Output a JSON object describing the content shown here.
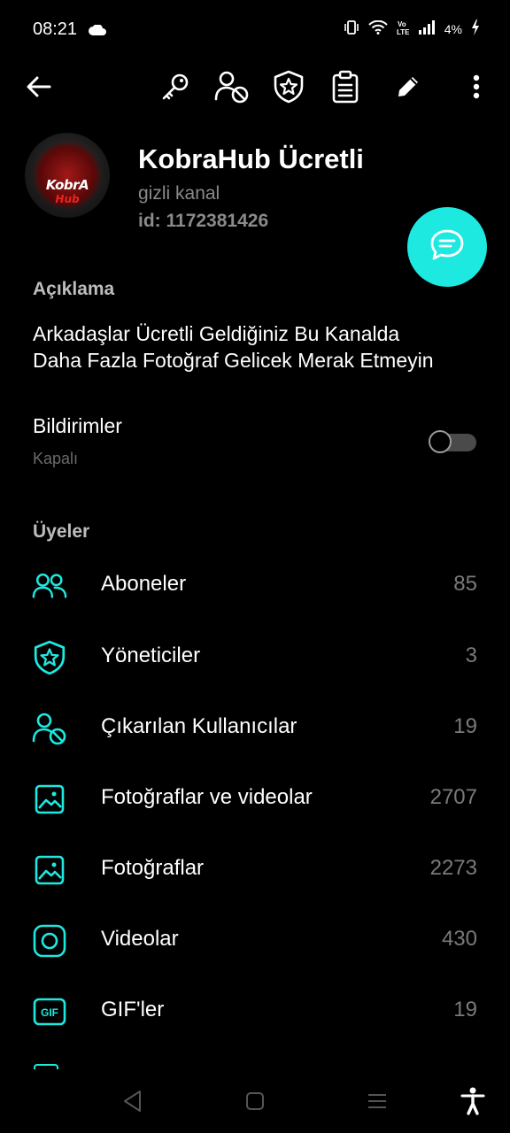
{
  "status_bar": {
    "time": "08:21",
    "battery": "4%",
    "icons": [
      "cloud-icon",
      "vibrate-icon",
      "wifi-icon",
      "volte-icon",
      "signal-icon",
      "battery-charging-icon"
    ]
  },
  "toolbar": {
    "icons": [
      "back-arrow-icon",
      "key-icon",
      "user-block-icon",
      "shield-star-icon",
      "clipboard-icon",
      "pencil-icon",
      "more-vertical-icon"
    ]
  },
  "channel": {
    "avatar_text_top": "KobrA",
    "avatar_text_bottom": "Hub",
    "name": "KobraHub Ücretli",
    "type": "gizli kanal",
    "id": "id: 1172381426"
  },
  "fab": {
    "icon": "chat-icon"
  },
  "description": {
    "header": "Açıklama",
    "text_line1": "Arkadaşlar Ücretli Geldiğiniz Bu Kanalda",
    "text_line2": "Daha Fazla Fotoğraf Gelicek Merak Etmeyin"
  },
  "notifications": {
    "label": "Bildirimler",
    "status": "Kapalı",
    "enabled": false
  },
  "members": {
    "header": "Üyeler",
    "items": [
      {
        "label": "Aboneler",
        "count": "85",
        "icon": "users-icon"
      },
      {
        "label": "Yöneticiler",
        "count": "3",
        "icon": "shield-star-icon"
      },
      {
        "label": "Çıkarılan Kullanıcılar",
        "count": "19",
        "icon": "user-block-icon"
      },
      {
        "label": "Fotoğraflar ve videolar",
        "count": "2707",
        "icon": "image-icon"
      },
      {
        "label": "Fotoğraflar",
        "count": "2273",
        "icon": "image-icon"
      },
      {
        "label": "Videolar",
        "count": "430",
        "icon": "video-circle-icon"
      },
      {
        "label": "GIF'ler",
        "count": "19",
        "icon": "gif-icon"
      }
    ]
  },
  "colors": {
    "accent": "#1de9e0",
    "background": "#000000",
    "secondary_text": "#8a8a8a",
    "count_text": "#7a7a7a"
  },
  "nav_bar": {
    "icons": [
      "back-triangle-icon",
      "home-square-icon",
      "recents-menu-icon",
      "accessibility-icon"
    ]
  }
}
